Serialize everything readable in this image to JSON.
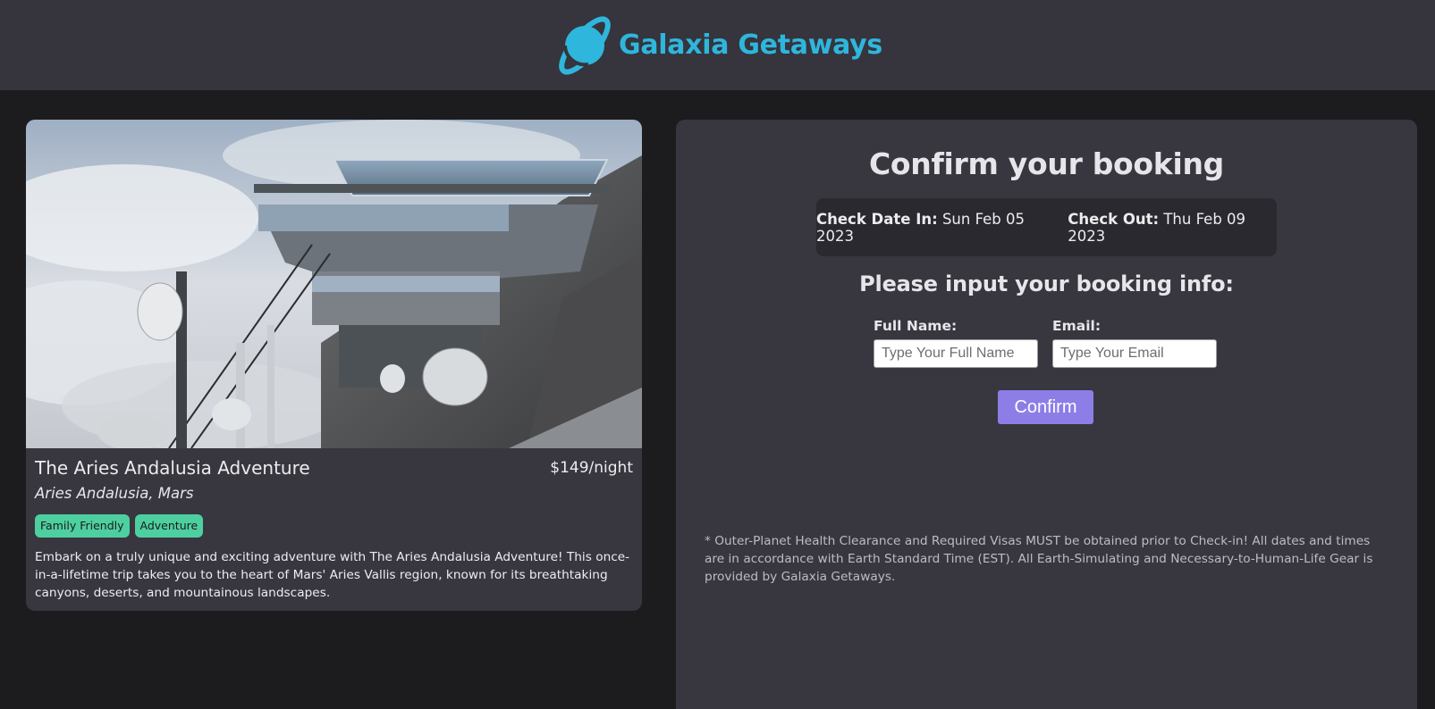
{
  "header": {
    "brand_name": "Galaxia Getaways",
    "logo_icon": "planet-icon",
    "accent_color": "#2fb6dc"
  },
  "listing": {
    "title": "The Aries Andalusia Adventure",
    "price": "$149/night",
    "location": "Aries Andalusia, Mars",
    "tags": [
      "Family Friendly",
      "Adventure"
    ],
    "description": "Embark on a truly unique and exciting adventure with The Aries Andalusia Adventure! This once-in-a-lifetime trip takes you to the heart of Mars' Aries Vallis region, known for its breathtaking canyons, deserts, and mountainous landscapes."
  },
  "booking": {
    "heading": "Confirm your booking",
    "check_in_label": "Check Date In:",
    "check_in_value": "Sun Feb 05 2023",
    "check_out_label": "Check Out:",
    "check_out_value": "Thu Feb 09 2023",
    "subheading": "Please input your booking info:",
    "name_label": "Full Name:",
    "name_placeholder": "Type Your Full Name",
    "name_value": "",
    "email_label": "Email:",
    "email_placeholder": "Type Your Email",
    "email_value": "",
    "confirm_label": "Confirm",
    "confirm_color": "#8c7ee6",
    "disclaimer": "* Outer-Planet Health Clearance and Required Visas MUST be obtained prior to Check-in! All dates and times are in accordance with Earth Standard Time (EST). All Earth-Simulating and Necessary-to-Human-Life Gear is provided by Galaxia Getaways."
  }
}
